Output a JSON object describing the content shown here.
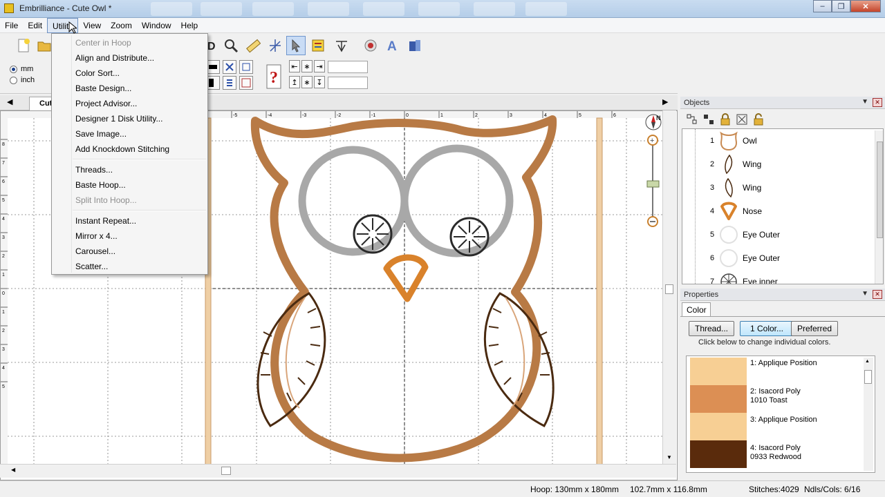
{
  "window": {
    "app_name": "Embrilliance",
    "title": "Embrilliance - Cute Owl *"
  },
  "menubar": {
    "items": [
      "File",
      "Edit",
      "Utility",
      "View",
      "Zoom",
      "Window",
      "Help"
    ]
  },
  "utility_menu": {
    "groups": [
      [
        {
          "label": "Center in Hoop",
          "disabled": true
        },
        {
          "label": "Align and Distribute...",
          "disabled": false
        },
        {
          "label": "Color Sort...",
          "disabled": false
        },
        {
          "label": "Baste Design...",
          "disabled": false
        },
        {
          "label": "Project Advisor...",
          "disabled": false
        },
        {
          "label": "Designer 1 Disk Utility...",
          "disabled": false
        },
        {
          "label": "Save Image...",
          "disabled": false
        },
        {
          "label": "Add Knockdown Stitching",
          "disabled": false
        }
      ],
      [
        {
          "label": "Threads...",
          "disabled": false
        },
        {
          "label": "Baste Hoop...",
          "disabled": false
        },
        {
          "label": "Split Into Hoop...",
          "disabled": true
        }
      ],
      [
        {
          "label": "Instant Repeat...",
          "disabled": false
        },
        {
          "label": "Mirror x 4...",
          "disabled": false
        },
        {
          "label": "Carousel...",
          "disabled": false
        },
        {
          "label": "Scatter...",
          "disabled": false
        }
      ]
    ]
  },
  "units": {
    "mm": "mm",
    "inch": "inch",
    "selected": "mm"
  },
  "document_tab": {
    "label": "Cut"
  },
  "ruler": {
    "top_ticks": [
      "-6",
      "-5",
      "-4",
      "-3",
      "-2",
      "-1",
      "0",
      "1",
      "2",
      "3",
      "4",
      "5",
      "6"
    ],
    "left_ticks": [
      "8",
      "7",
      "6",
      "5",
      "4",
      "3",
      "2",
      "1",
      "0",
      "1",
      "2",
      "3",
      "4",
      "5"
    ]
  },
  "objects_panel": {
    "title": "Objects",
    "items": [
      {
        "num": "1",
        "name": "Owl",
        "icon": "owl-outline-icon"
      },
      {
        "num": "2",
        "name": "Wing",
        "icon": "wing-icon"
      },
      {
        "num": "3",
        "name": "Wing",
        "icon": "wing-icon"
      },
      {
        "num": "4",
        "name": "Nose",
        "icon": "nose-icon"
      },
      {
        "num": "5",
        "name": "Eye Outer",
        "icon": "eye-outer-icon"
      },
      {
        "num": "6",
        "name": "Eye Outer",
        "icon": "eye-outer-icon"
      },
      {
        "num": "7",
        "name": "Eye inner",
        "icon": "eye-inner-icon"
      }
    ]
  },
  "properties_panel": {
    "title": "Properties",
    "tab": "Color",
    "buttons": {
      "thread": "Thread...",
      "one_color": "1 Color...",
      "preferred": "Preferred"
    },
    "hint": "Click below to change individual colors.",
    "colors": [
      {
        "line1": "1: Applique Position",
        "line2": "",
        "hex": "#f7cf94"
      },
      {
        "line1": "2: Isacord Poly",
        "line2": "1010 Toast",
        "hex": "#dc8f54"
      },
      {
        "line1": "3: Applique Position",
        "line2": "",
        "hex": "#f7cf94"
      },
      {
        "line1": "4: Isacord Poly",
        "line2": "0933 Redwood",
        "hex": "#5a2b0c"
      }
    ]
  },
  "statusbar": {
    "hoop": "Hoop: 130mm x 180mm",
    "size": "102.7mm x 116.8mm",
    "stitches": "Stitches:4029",
    "ndls": "Ndls/Cols: 6/16"
  },
  "colors": {
    "owl_brown": "#b87a45",
    "nose_orange": "#d9822b",
    "eye_gray": "#a8a8a8",
    "wing_dark": "#4a2a10",
    "hoop_wood": "#e8c49a"
  }
}
